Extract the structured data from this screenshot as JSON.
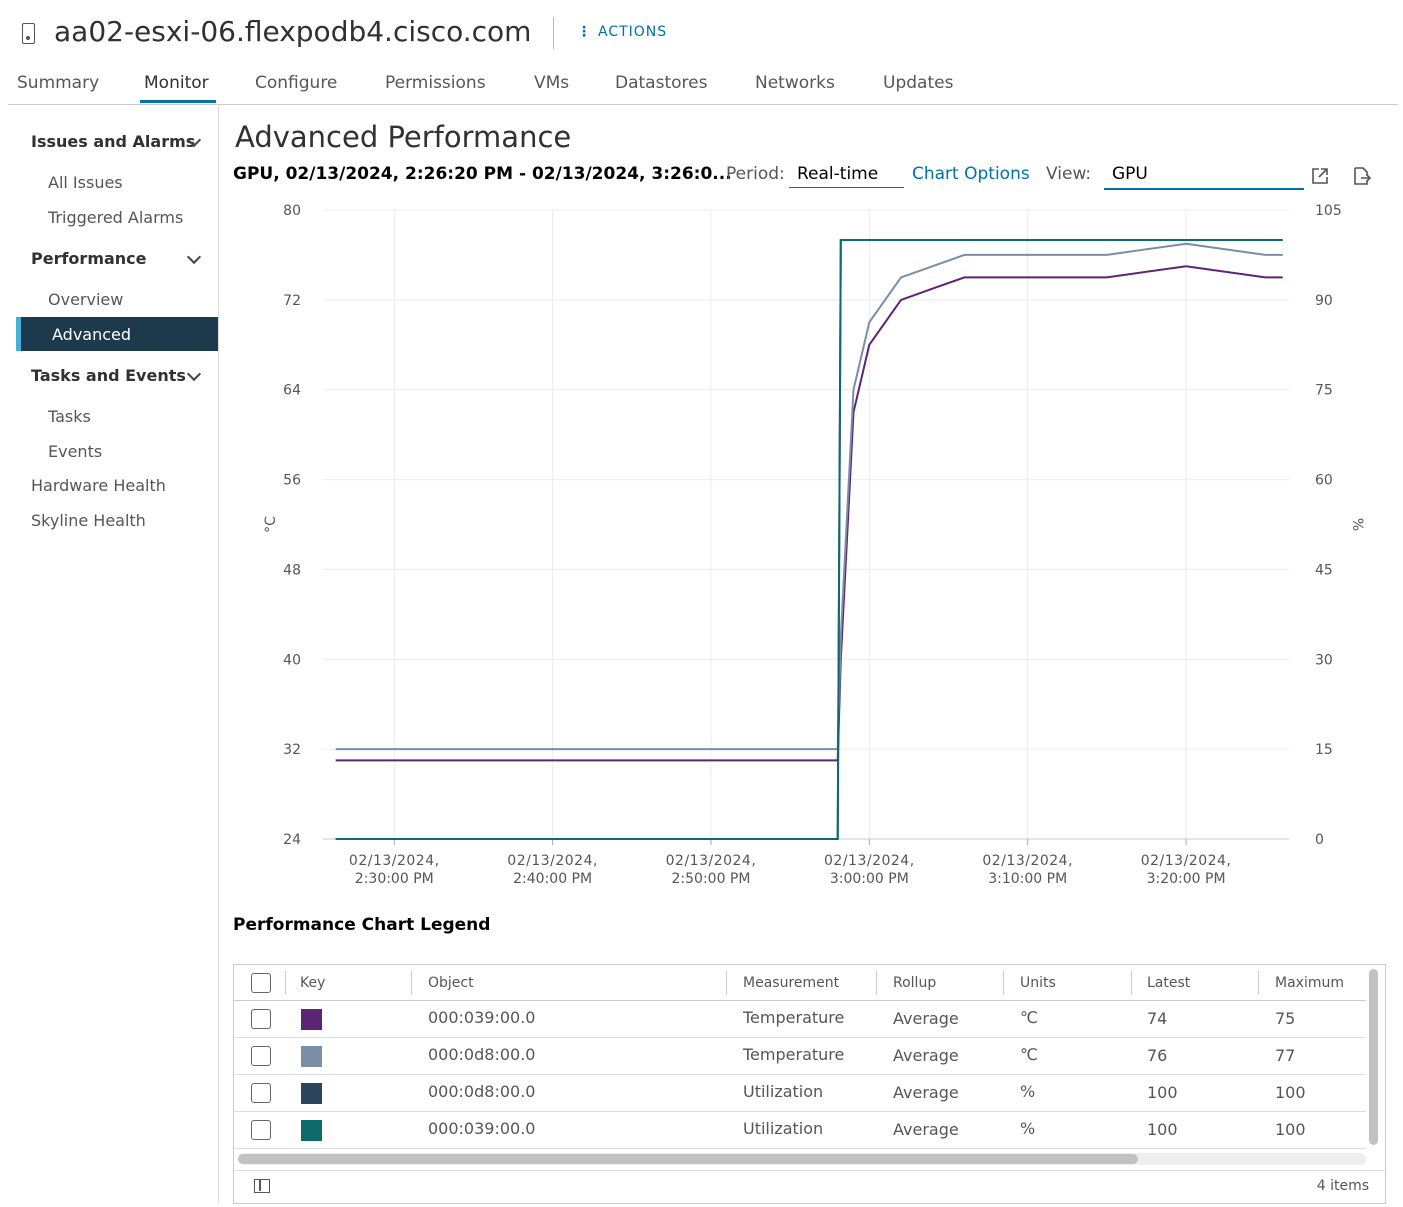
{
  "host": {
    "title": "aa02-esxi-06.flexpodb4.cisco.com",
    "actions_label": "ACTIONS"
  },
  "tabs": [
    "Summary",
    "Monitor",
    "Configure",
    "Permissions",
    "VMs",
    "Datastores",
    "Networks",
    "Updates"
  ],
  "active_tab": "Monitor",
  "sidebar": {
    "issues_head": "Issues and Alarms",
    "all_issues": "All Issues",
    "triggered_alarms": "Triggered Alarms",
    "performance_head": "Performance",
    "overview": "Overview",
    "advanced": "Advanced",
    "tasks_head": "Tasks and Events",
    "tasks": "Tasks",
    "events": "Events",
    "hardware_health": "Hardware Health",
    "skyline_health": "Skyline Health"
  },
  "main": {
    "title": "Advanced Performance",
    "range": "GPU, 02/13/2024, 2:26:20 PM - 02/13/2024, 3:26:0...",
    "period_label": "Period:",
    "period_value": "Real-time",
    "chart_options": "Chart Options",
    "view_label": "View:",
    "view_value": "GPU"
  },
  "chart_data": {
    "type": "line",
    "left_axis": {
      "label": "°C",
      "ticks": [
        80,
        72,
        64,
        56,
        48,
        40,
        32,
        24
      ],
      "ylim": [
        24,
        80
      ]
    },
    "right_axis": {
      "label": "%",
      "ticks": [
        105,
        90,
        75,
        60,
        45,
        30,
        15,
        0
      ],
      "ylim": [
        0,
        105
      ]
    },
    "x_ticks": [
      [
        "02/13/2024,",
        "2:30:00 PM"
      ],
      [
        "02/13/2024,",
        "2:40:00 PM"
      ],
      [
        "02/13/2024,",
        "2:50:00 PM"
      ],
      [
        "02/13/2024,",
        "3:00:00 PM"
      ],
      [
        "02/13/2024,",
        "3:10:00 PM"
      ],
      [
        "02/13/2024,",
        "3:20:00 PM"
      ]
    ],
    "x_minutes": [
      26.3,
      30,
      40,
      50,
      58,
      58.2,
      59,
      60,
      62,
      64,
      66,
      70,
      75,
      80,
      85,
      86.1
    ],
    "series": [
      {
        "key": "000:039:00.0 Temperature",
        "axis": "left",
        "color": "#5c2474",
        "values": [
          31,
          31,
          31,
          31,
          31,
          40,
          62,
          68,
          72,
          73,
          74,
          74,
          74,
          75,
          74,
          74
        ]
      },
      {
        "key": "000:0d8:00.0 Temperature",
        "axis": "left",
        "color": "#7a8ea8",
        "values": [
          32,
          32,
          32,
          32,
          32,
          42,
          64,
          70,
          74,
          75,
          76,
          76,
          76,
          77,
          76,
          76
        ]
      },
      {
        "key": "000:0d8:00.0 Utilization",
        "axis": "right",
        "color": "#2e4560",
        "values": [
          0,
          0,
          0,
          0,
          0,
          100,
          100,
          100,
          100,
          100,
          100,
          100,
          100,
          100,
          100,
          100
        ]
      },
      {
        "key": "000:039:00.0 Utilization",
        "axis": "right",
        "color": "#0e6b6b",
        "values": [
          0,
          0,
          0,
          0,
          0,
          100,
          100,
          100,
          100,
          100,
          100,
          100,
          100,
          100,
          100,
          100
        ]
      }
    ]
  },
  "legend": {
    "title": "Performance Chart Legend",
    "headers": [
      "Key",
      "Object",
      "Measurement",
      "Rollup",
      "Units",
      "Latest",
      "Maximum"
    ],
    "rows": [
      {
        "color": "#5c2474",
        "object": "000:039:00.0",
        "measurement": "Temperature",
        "rollup": "Average",
        "units": "℃",
        "latest": "74",
        "maximum": "75"
      },
      {
        "color": "#7a8ea8",
        "object": "000:0d8:00.0",
        "measurement": "Temperature",
        "rollup": "Average",
        "units": "℃",
        "latest": "76",
        "maximum": "77"
      },
      {
        "color": "#2e4560",
        "object": "000:0d8:00.0",
        "measurement": "Utilization",
        "rollup": "Average",
        "units": "%",
        "latest": "100",
        "maximum": "100"
      },
      {
        "color": "#0e6b6b",
        "object": "000:039:00.0",
        "measurement": "Utilization",
        "rollup": "Average",
        "units": "%",
        "latest": "100",
        "maximum": "100"
      }
    ],
    "footer": "4 items"
  }
}
